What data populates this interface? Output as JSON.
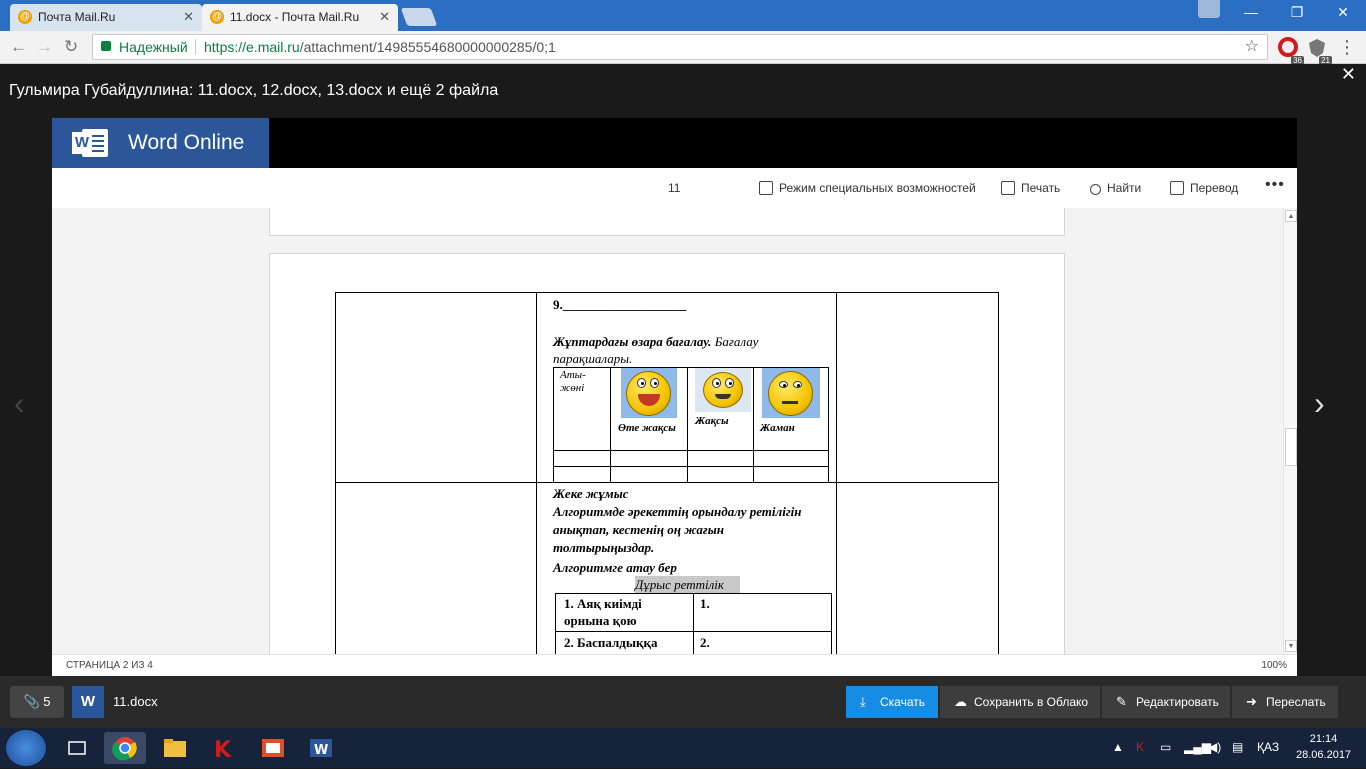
{
  "browser": {
    "tabs": [
      {
        "label": "Почта Mail.Ru",
        "active": false
      },
      {
        "label": "11.docx - Почта Mail.Ru",
        "active": true
      }
    ],
    "secure_label": "Надежный",
    "url_host": "https://e.mail.ru",
    "url_path": "/attachment/14985554680000000285/0;1",
    "ext_badge_1": "36",
    "ext_badge_2": "21"
  },
  "attachment": {
    "title": "Гульмира Губайдуллина: 11.docx, 12.docx, 13.docx и ещё 2 файла"
  },
  "word": {
    "brand": "Word Online",
    "doc_name": "11",
    "commands": [
      "Режим специальных возможностей",
      "Печать",
      "Найти",
      "Перевод"
    ],
    "status_page": "СТРАНИЦА 2 ИЗ 4",
    "zoom": "100%"
  },
  "document": {
    "item_number": "9.___________________",
    "peer_title": "Жұптардағы өзара бағалау.",
    "peer_rest": "Бағалау парақшалары.",
    "col_name": "Аты-жөні",
    "rating_labels": [
      "Өте жақсы",
      "Жақсы",
      "Жаман"
    ],
    "task_title": "Жеке жұмыс",
    "task_text": "Алгоритмде әрекеттің  орындалу ретілігін анықтап, кестенің оң жағын толтырыңыздар.",
    "task_sub": "Алгоритмге атау бер",
    "order_caption": "Дұрыс реттілік",
    "rows": [
      {
        "left": "1.  Аяқ киімді орнына қою",
        "right": "1."
      },
      {
        "left": "2.  Баспалдыққа",
        "right": "2."
      }
    ]
  },
  "bottom_bar": {
    "attach_count": "5",
    "file_name": "11.docx",
    "buttons": [
      "Скачать",
      "Сохранить в Облако",
      "Редактировать",
      "Переслать"
    ]
  },
  "taskbar": {
    "lang": "ҚАЗ",
    "time": "21:14",
    "date": "28.06.2017"
  }
}
